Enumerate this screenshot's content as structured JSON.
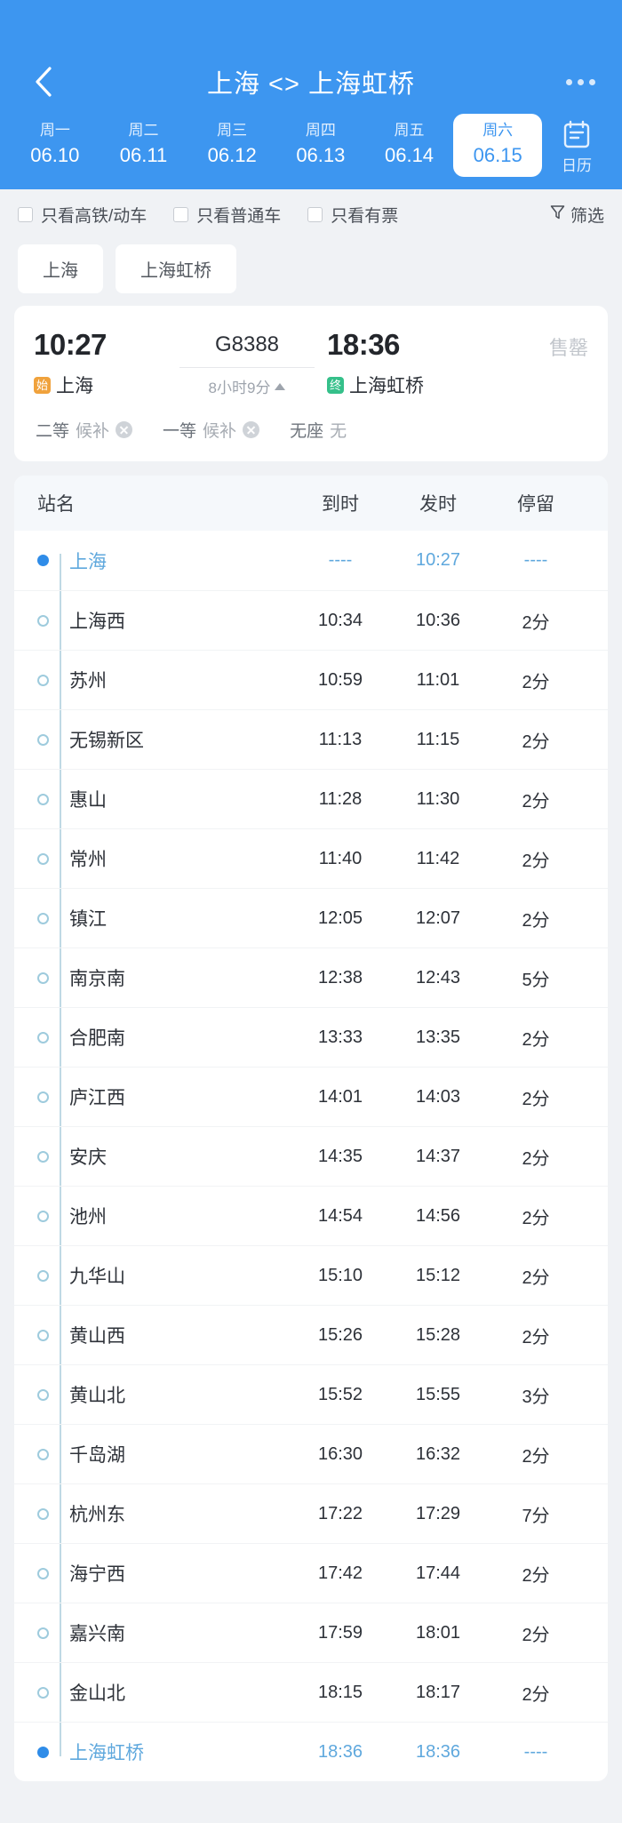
{
  "theme": {
    "header_bg": "#3d96f0",
    "page_bg": "#f0f2f5",
    "card_bg": "#ffffff",
    "accent": "#2f8ce8",
    "terminal_text": "#5fa8dd",
    "rail": "#bfd9e4",
    "start_badge_bg": "#f0a23c",
    "end_badge_bg": "#35c08a"
  },
  "header": {
    "back_icon": "chevron-left-icon",
    "title": "上海 <> 上海虹桥",
    "more_icon": "more-horizontal-icon",
    "dates": [
      {
        "dow": "周一",
        "date": "06.10",
        "active": false
      },
      {
        "dow": "周二",
        "date": "06.11",
        "active": false
      },
      {
        "dow": "周三",
        "date": "06.12",
        "active": false
      },
      {
        "dow": "周四",
        "date": "06.13",
        "active": false
      },
      {
        "dow": "周五",
        "date": "06.14",
        "active": false
      },
      {
        "dow": "周六",
        "date": "06.15",
        "active": true
      }
    ],
    "calendar": {
      "icon": "calendar-icon",
      "label": "日历"
    }
  },
  "filters": {
    "options": [
      {
        "label": "只看高铁/动车",
        "checked": false
      },
      {
        "label": "只看普通车",
        "checked": false
      },
      {
        "label": "只看有票",
        "checked": false
      }
    ],
    "sort": {
      "icon": "funnel-icon",
      "label": "筛选"
    }
  },
  "station_chips": [
    {
      "label": "上海"
    },
    {
      "label": "上海虹桥"
    }
  ],
  "train": {
    "depart_time": "10:27",
    "depart_badge": "始",
    "depart_station": "上海",
    "train_no": "G8388",
    "duration": "8小时9分",
    "duration_icon": "triangle-up-icon",
    "arrive_time": "18:36",
    "arrive_badge": "终",
    "arrive_station": "上海虹桥",
    "status": "售罄",
    "seats": [
      {
        "type": "二等",
        "value": "候补",
        "icon": "x-circle-icon",
        "has_icon": true
      },
      {
        "type": "一等",
        "value": "候补",
        "icon": "x-circle-icon",
        "has_icon": true
      },
      {
        "type": "无座",
        "value": "无",
        "has_icon": false
      }
    ]
  },
  "stops_table": {
    "headers": {
      "name": "站名",
      "arrive": "到时",
      "depart": "发时",
      "stay": "停留"
    },
    "rows": [
      {
        "name": "上海",
        "arrive": "----",
        "depart": "10:27",
        "stay": "----",
        "terminal": true,
        "filled": true
      },
      {
        "name": "上海西",
        "arrive": "10:34",
        "depart": "10:36",
        "stay": "2分",
        "terminal": false,
        "filled": false
      },
      {
        "name": "苏州",
        "arrive": "10:59",
        "depart": "11:01",
        "stay": "2分",
        "terminal": false,
        "filled": false
      },
      {
        "name": "无锡新区",
        "arrive": "11:13",
        "depart": "11:15",
        "stay": "2分",
        "terminal": false,
        "filled": false
      },
      {
        "name": "惠山",
        "arrive": "11:28",
        "depart": "11:30",
        "stay": "2分",
        "terminal": false,
        "filled": false
      },
      {
        "name": "常州",
        "arrive": "11:40",
        "depart": "11:42",
        "stay": "2分",
        "terminal": false,
        "filled": false
      },
      {
        "name": "镇江",
        "arrive": "12:05",
        "depart": "12:07",
        "stay": "2分",
        "terminal": false,
        "filled": false
      },
      {
        "name": "南京南",
        "arrive": "12:38",
        "depart": "12:43",
        "stay": "5分",
        "terminal": false,
        "filled": false
      },
      {
        "name": "合肥南",
        "arrive": "13:33",
        "depart": "13:35",
        "stay": "2分",
        "terminal": false,
        "filled": false
      },
      {
        "name": "庐江西",
        "arrive": "14:01",
        "depart": "14:03",
        "stay": "2分",
        "terminal": false,
        "filled": false
      },
      {
        "name": "安庆",
        "arrive": "14:35",
        "depart": "14:37",
        "stay": "2分",
        "terminal": false,
        "filled": false
      },
      {
        "name": "池州",
        "arrive": "14:54",
        "depart": "14:56",
        "stay": "2分",
        "terminal": false,
        "filled": false
      },
      {
        "name": "九华山",
        "arrive": "15:10",
        "depart": "15:12",
        "stay": "2分",
        "terminal": false,
        "filled": false
      },
      {
        "name": "黄山西",
        "arrive": "15:26",
        "depart": "15:28",
        "stay": "2分",
        "terminal": false,
        "filled": false
      },
      {
        "name": "黄山北",
        "arrive": "15:52",
        "depart": "15:55",
        "stay": "3分",
        "terminal": false,
        "filled": false
      },
      {
        "name": "千岛湖",
        "arrive": "16:30",
        "depart": "16:32",
        "stay": "2分",
        "terminal": false,
        "filled": false
      },
      {
        "name": "杭州东",
        "arrive": "17:22",
        "depart": "17:29",
        "stay": "7分",
        "terminal": false,
        "filled": false
      },
      {
        "name": "海宁西",
        "arrive": "17:42",
        "depart": "17:44",
        "stay": "2分",
        "terminal": false,
        "filled": false
      },
      {
        "name": "嘉兴南",
        "arrive": "17:59",
        "depart": "18:01",
        "stay": "2分",
        "terminal": false,
        "filled": false
      },
      {
        "name": "金山北",
        "arrive": "18:15",
        "depart": "18:17",
        "stay": "2分",
        "terminal": false,
        "filled": false
      },
      {
        "name": "上海虹桥",
        "arrive": "18:36",
        "depart": "18:36",
        "stay": "----",
        "terminal": true,
        "filled": true
      }
    ]
  }
}
